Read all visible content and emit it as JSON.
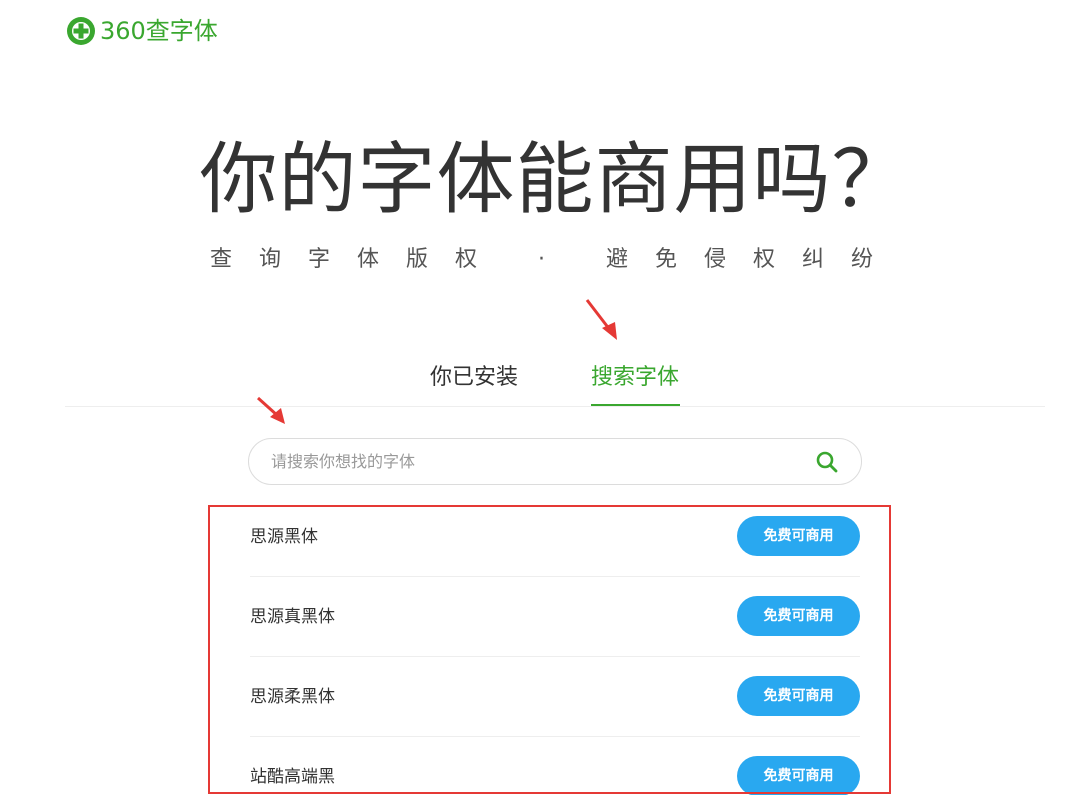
{
  "brand": {
    "name": "360查字体",
    "color": "#3aa72f"
  },
  "hero": {
    "title": "你的字体能商用吗？",
    "subtitle": "查询字体版权 · 避免侵权纠纷"
  },
  "tabs": [
    {
      "label": "你已安装",
      "active": false
    },
    {
      "label": "搜索字体",
      "active": true
    }
  ],
  "search": {
    "placeholder": "请搜索你想找的字体",
    "value": "",
    "icon": "search-icon"
  },
  "fonts": [
    {
      "name": "思源黑体",
      "license": "免费可商用"
    },
    {
      "name": "思源真黑体",
      "license": "免费可商用"
    },
    {
      "name": "思源柔黑体",
      "license": "免费可商用"
    },
    {
      "name": "站酷高端黑",
      "license": "免费可商用"
    }
  ],
  "colors": {
    "accent": "#3aa72f",
    "badge": "#29a8f0",
    "annotation": "#e53935"
  }
}
